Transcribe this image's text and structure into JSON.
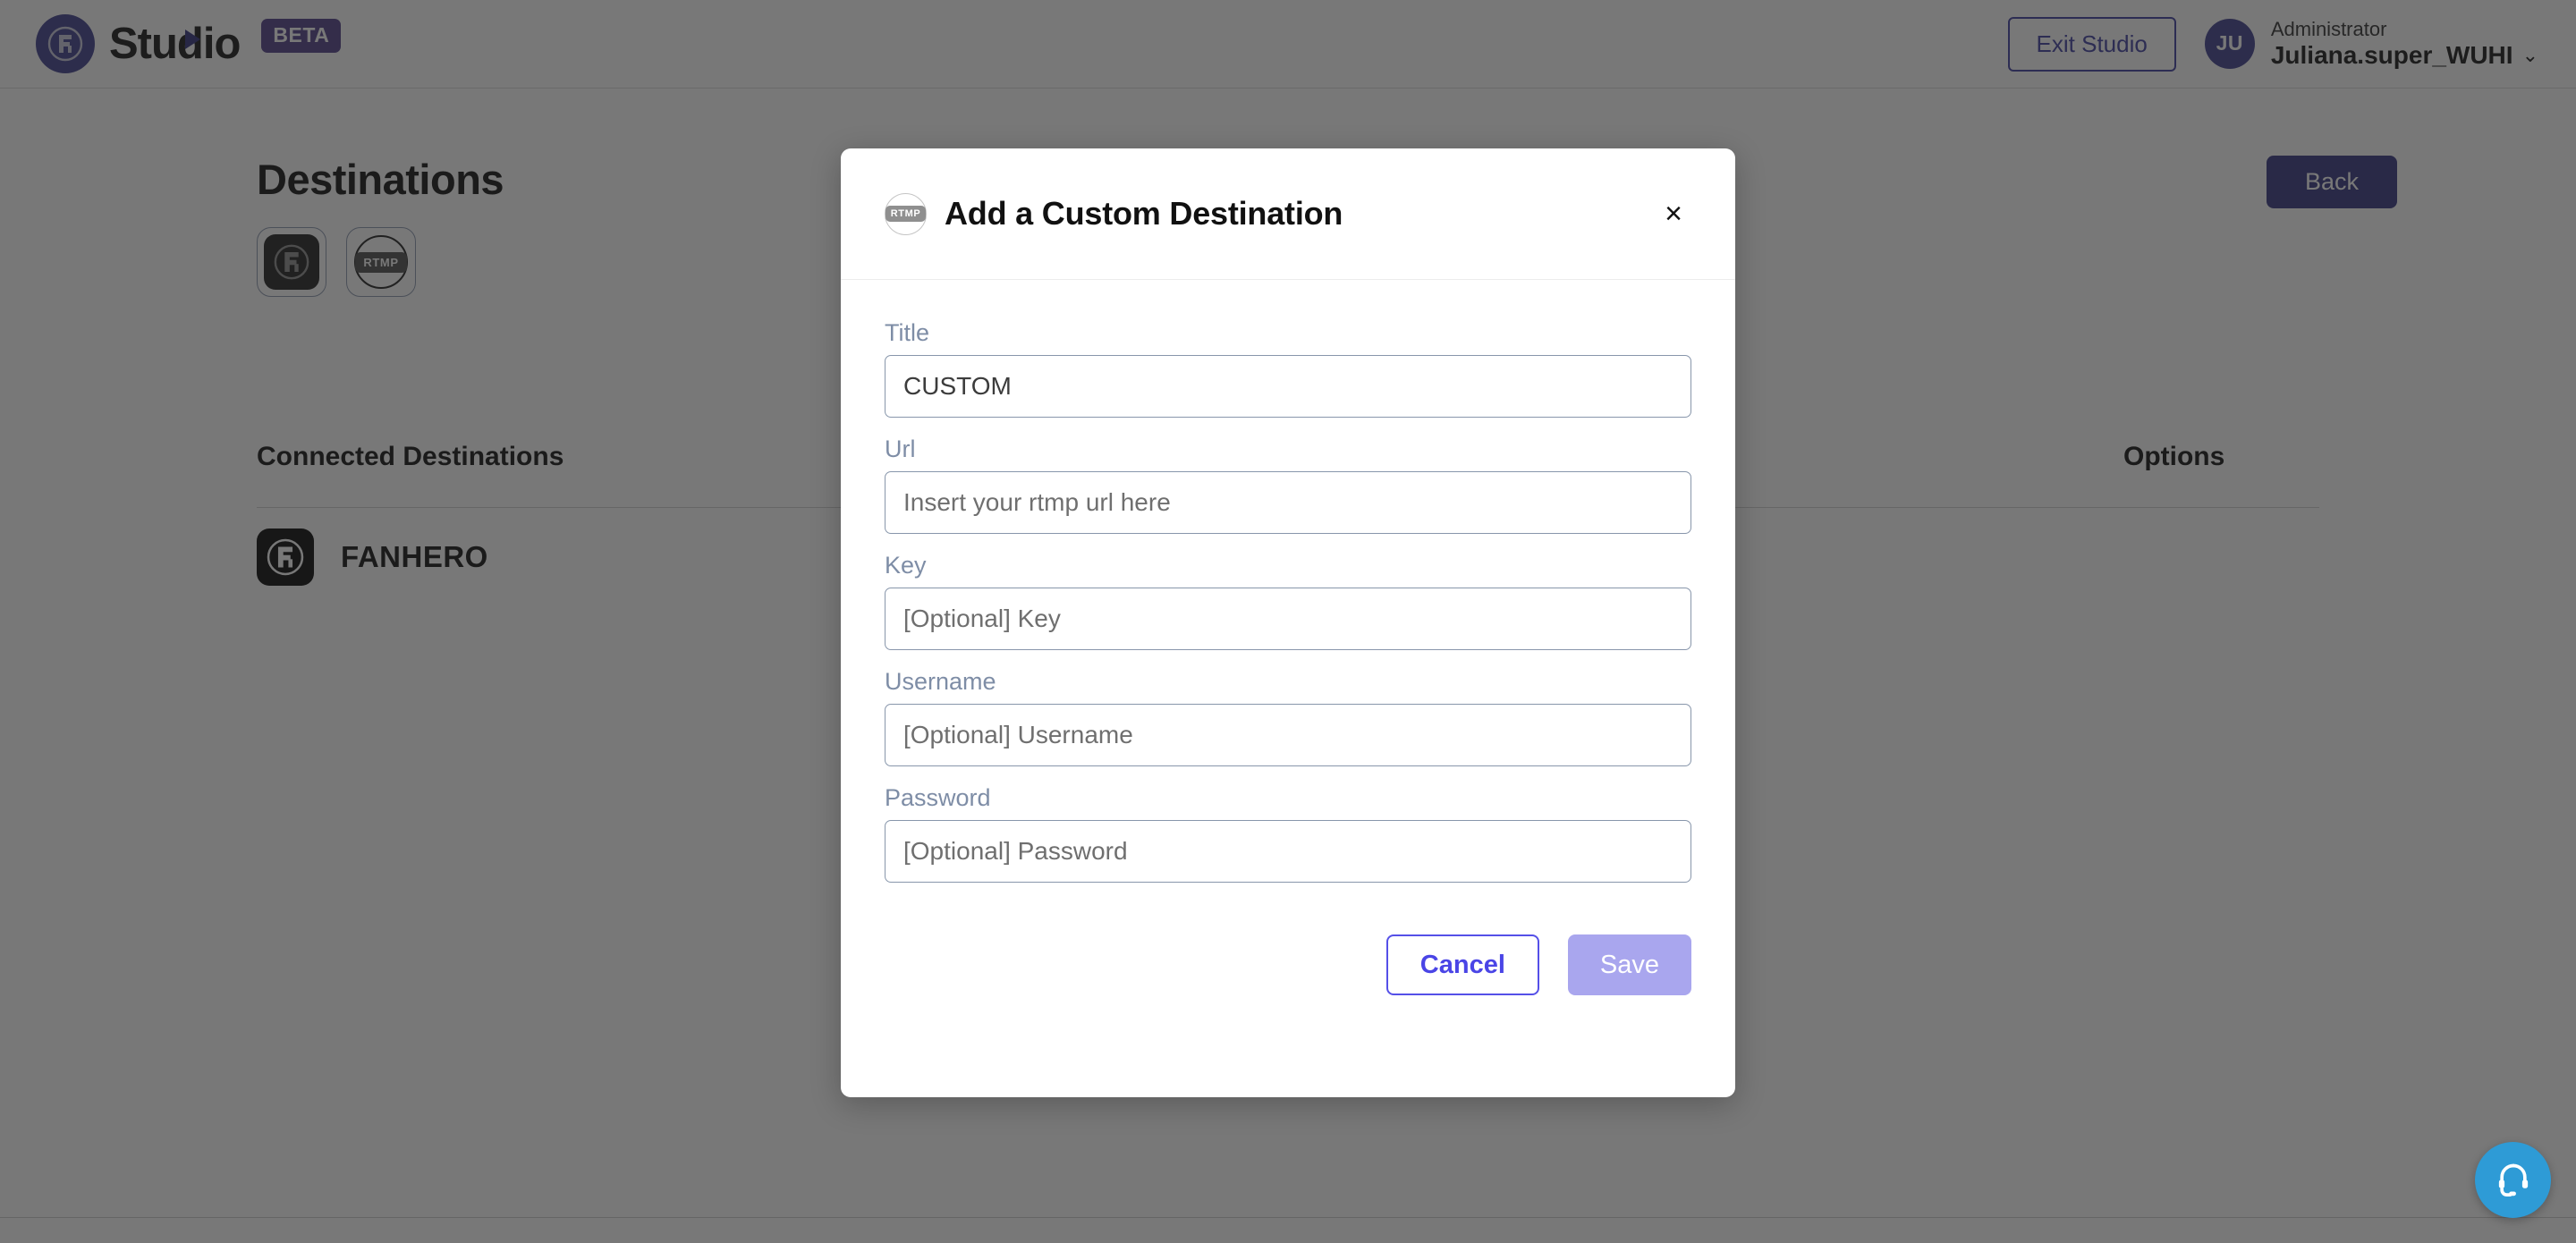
{
  "header": {
    "brand_name": "Studio",
    "beta_badge": "BETA",
    "exit_button": "Exit Studio",
    "avatar_initials": "JU",
    "user_role": "Administrator",
    "user_name": "Juliana.super_WUHI",
    "chevron": "⌄"
  },
  "page": {
    "title": "Destinations",
    "back_button": "Back",
    "tiles": [
      {
        "name": "fanhero-destination-tile",
        "label": ""
      },
      {
        "name": "rtmp-destination-tile",
        "label": "RTMP"
      }
    ],
    "connected_header": "Connected Destinations",
    "options_header": "Options",
    "rows": [
      {
        "name": "FANHERO"
      }
    ]
  },
  "modal": {
    "icon_label": "RTMP",
    "title": "Add a Custom Destination",
    "close_label": "×",
    "fields": [
      {
        "label": "Title",
        "value": "CUSTOM",
        "placeholder": ""
      },
      {
        "label": "Url",
        "value": "",
        "placeholder": "Insert your rtmp url here"
      },
      {
        "label": "Key",
        "value": "",
        "placeholder": "[Optional] Key"
      },
      {
        "label": "Username",
        "value": "",
        "placeholder": "[Optional] Username"
      },
      {
        "label": "Password",
        "value": "",
        "placeholder": "[Optional] Password"
      }
    ],
    "cancel_button": "Cancel",
    "save_button": "Save"
  },
  "support": {
    "tooltip": "support"
  },
  "colors": {
    "brand_indigo": "#3a3a8c",
    "beta_purple": "#4e3a87",
    "accent_indigo": "#4a45e6",
    "save_disabled": "#a9a6ee",
    "back_button": "#31317e",
    "label_blue_gray": "#7e8da6",
    "input_border": "#8896ab",
    "support_blue": "#2e9bd6",
    "overlay": "rgba(37,37,37,0.62)"
  }
}
